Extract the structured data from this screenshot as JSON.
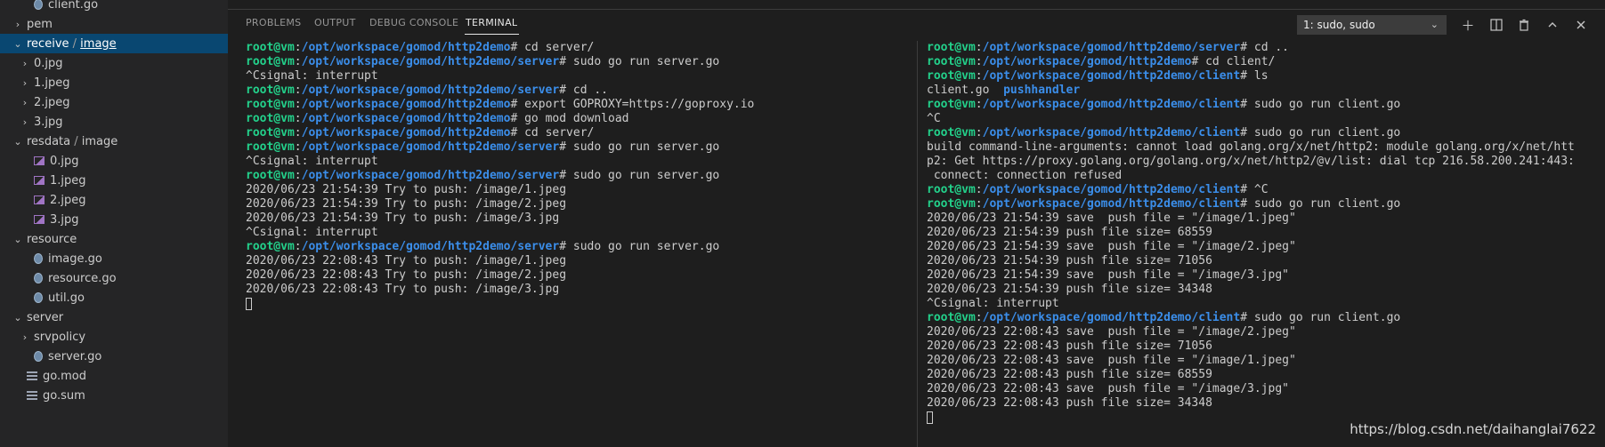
{
  "sidebar": {
    "items": [
      {
        "label": "client.go",
        "icon": "gopher-icon",
        "indent": 1,
        "chevron": ""
      },
      {
        "label": "pem",
        "icon": "",
        "indent": 0,
        "chevron": "›"
      },
      {
        "label_a": "receive",
        "label_sep": " / ",
        "label_b": "image",
        "icon": "",
        "indent": 0,
        "chevron": "⌄",
        "selected": true
      },
      {
        "label": "0.jpg",
        "icon": "",
        "indent": 1,
        "chevron": "›"
      },
      {
        "label": "1.jpeg",
        "icon": "",
        "indent": 1,
        "chevron": "›"
      },
      {
        "label": "2.jpeg",
        "icon": "",
        "indent": 1,
        "chevron": "›"
      },
      {
        "label": "3.jpg",
        "icon": "",
        "indent": 1,
        "chevron": "›"
      },
      {
        "label_a": "resdata",
        "label_sep": " / ",
        "label_b": "image",
        "icon": "",
        "indent": 0,
        "chevron": "⌄"
      },
      {
        "label": "0.jpg",
        "icon": "image-icon",
        "indent": 1,
        "chevron": ""
      },
      {
        "label": "1.jpeg",
        "icon": "image-icon",
        "indent": 1,
        "chevron": ""
      },
      {
        "label": "2.jpeg",
        "icon": "image-icon",
        "indent": 1,
        "chevron": ""
      },
      {
        "label": "3.jpg",
        "icon": "image-icon",
        "indent": 1,
        "chevron": ""
      },
      {
        "label": "resource",
        "icon": "",
        "indent": 0,
        "chevron": "⌄"
      },
      {
        "label": "image.go",
        "icon": "gopher-icon",
        "indent": 1,
        "chevron": ""
      },
      {
        "label": "resource.go",
        "icon": "gopher-icon",
        "indent": 1,
        "chevron": ""
      },
      {
        "label": "util.go",
        "icon": "gopher-icon",
        "indent": 1,
        "chevron": ""
      },
      {
        "label": "server",
        "icon": "",
        "indent": 0,
        "chevron": "⌄"
      },
      {
        "label": "srvpolicy",
        "icon": "",
        "indent": 1,
        "chevron": "›"
      },
      {
        "label": "server.go",
        "icon": "gopher-icon",
        "indent": 1,
        "chevron": ""
      },
      {
        "label": "go.mod",
        "icon": "lines-icon",
        "indent": 0,
        "chevron": ""
      },
      {
        "label": "go.sum",
        "icon": "lines-icon",
        "indent": 0,
        "chevron": ""
      }
    ]
  },
  "panel": {
    "tabs": [
      {
        "label": "PROBLEMS"
      },
      {
        "label": "OUTPUT"
      },
      {
        "label": "DEBUG CONSOLE"
      },
      {
        "label": "TERMINAL",
        "active": true
      }
    ],
    "terminal_select": "1: sudo, sudo",
    "icons": [
      "plus-icon",
      "split-icon",
      "trash-icon",
      "chevron-up-icon",
      "close-icon"
    ]
  },
  "terminal_left": [
    {
      "user": "root@vm",
      "path": "/opt/workspace/gomod/http2demo",
      "cmd": "# cd server/"
    },
    {
      "user": "root@vm",
      "path": "/opt/workspace/gomod/http2demo/server",
      "cmd": "# sudo go run server.go"
    },
    {
      "text": "^Csignal: interrupt"
    },
    {
      "user": "root@vm",
      "path": "/opt/workspace/gomod/http2demo/server",
      "cmd": "# cd .."
    },
    {
      "user": "root@vm",
      "path": "/opt/workspace/gomod/http2demo",
      "cmd": "# export GOPROXY=https://goproxy.io"
    },
    {
      "user": "root@vm",
      "path": "/opt/workspace/gomod/http2demo",
      "cmd": "# go mod download"
    },
    {
      "user": "root@vm",
      "path": "/opt/workspace/gomod/http2demo",
      "cmd": "# cd server/"
    },
    {
      "user": "root@vm",
      "path": "/opt/workspace/gomod/http2demo/server",
      "cmd": "# sudo go run server.go"
    },
    {
      "text": "^Csignal: interrupt"
    },
    {
      "user": "root@vm",
      "path": "/opt/workspace/gomod/http2demo/server",
      "cmd": "# sudo go run server.go"
    },
    {
      "text": "2020/06/23 21:54:39 Try to push: /image/1.jpeg"
    },
    {
      "text": "2020/06/23 21:54:39 Try to push: /image/2.jpeg"
    },
    {
      "text": "2020/06/23 21:54:39 Try to push: /image/3.jpg"
    },
    {
      "text": "^Csignal: interrupt"
    },
    {
      "user": "root@vm",
      "path": "/opt/workspace/gomod/http2demo/server",
      "cmd": "# sudo go run server.go"
    },
    {
      "text": "2020/06/23 22:08:43 Try to push: /image/1.jpeg"
    },
    {
      "text": "2020/06/23 22:08:43 Try to push: /image/2.jpeg"
    },
    {
      "text": "2020/06/23 22:08:43 Try to push: /image/3.jpg"
    },
    {
      "cursor": true
    }
  ],
  "terminal_right": [
    {
      "user": "root@vm",
      "path": "/opt/workspace/gomod/http2demo/server",
      "cmd": "# cd .."
    },
    {
      "user": "root@vm",
      "path": "/opt/workspace/gomod/http2demo",
      "cmd": "# cd client/"
    },
    {
      "user": "root@vm",
      "path": "/opt/workspace/gomod/http2demo/client",
      "cmd": "# ls"
    },
    {
      "text": "client.go  ",
      "dir": "pushhandler"
    },
    {
      "user": "root@vm",
      "path": "/opt/workspace/gomod/http2demo/client",
      "cmd": "# sudo go run client.go"
    },
    {
      "text": "^C"
    },
    {
      "user": "root@vm",
      "path": "/opt/workspace/gomod/http2demo/client",
      "cmd": "# sudo go run client.go"
    },
    {
      "text": "build command-line-arguments: cannot load golang.org/x/net/http2: module golang.org/x/net/htt"
    },
    {
      "text": "p2: Get https://proxy.golang.org/golang.org/x/net/http2/@v/list: dial tcp 216.58.200.241:443:"
    },
    {
      "text": " connect: connection refused"
    },
    {
      "user": "root@vm",
      "path": "/opt/workspace/gomod/http2demo/client",
      "cmd": "# ^C"
    },
    {
      "user": "root@vm",
      "path": "/opt/workspace/gomod/http2demo/client",
      "cmd": "# sudo go run client.go"
    },
    {
      "text": "2020/06/23 21:54:39 save  push file = \"/image/1.jpeg\""
    },
    {
      "text": "2020/06/23 21:54:39 push file size= 68559"
    },
    {
      "text": "2020/06/23 21:54:39 save  push file = \"/image/2.jpeg\""
    },
    {
      "text": "2020/06/23 21:54:39 push file size= 71056"
    },
    {
      "text": "2020/06/23 21:54:39 save  push file = \"/image/3.jpg\""
    },
    {
      "text": "2020/06/23 21:54:39 push file size= 34348"
    },
    {
      "text": "^Csignal: interrupt"
    },
    {
      "user": "root@vm",
      "path": "/opt/workspace/gomod/http2demo/client",
      "cmd": "# sudo go run client.go"
    },
    {
      "text": "2020/06/23 22:08:43 save  push file = \"/image/2.jpeg\""
    },
    {
      "text": "2020/06/23 22:08:43 push file size= 71056"
    },
    {
      "text": "2020/06/23 22:08:43 save  push file = \"/image/1.jpeg\""
    },
    {
      "text": "2020/06/23 22:08:43 push file size= 68559"
    },
    {
      "text": "2020/06/23 22:08:43 save  push file = \"/image/3.jpg\""
    },
    {
      "text": "2020/06/23 22:08:43 push file size= 34348"
    },
    {
      "cursor": true
    }
  ],
  "watermark": "https://blog.csdn.net/daihanglai7622",
  "colors": {
    "prompt_user": "#23d18b",
    "prompt_path": "#3b8eea",
    "selection": "#094771",
    "sidebar_bg": "#252526",
    "panel_bg": "#1e1e1e"
  }
}
